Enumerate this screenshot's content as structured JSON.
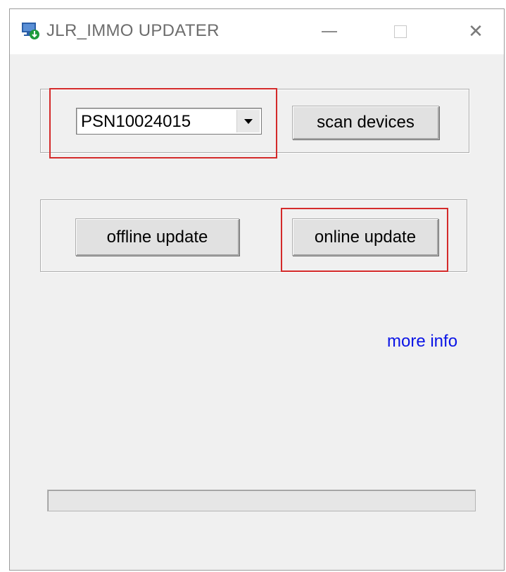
{
  "window": {
    "title": "JLR_IMMO UPDATER",
    "icon": "monitor-green-arrow-icon",
    "controls": [
      "minimize-icon",
      "maximize-icon",
      "close-icon"
    ],
    "close_glyph": "✕"
  },
  "device_select": {
    "selected_value": "PSN10024015"
  },
  "buttons": {
    "scan_devices": "scan devices",
    "offline_update": "offline update",
    "online_update": "online update"
  },
  "link": {
    "more_info": "more info",
    "color": "#0a14e6"
  },
  "progress": {
    "value": 0
  },
  "highlight_color": "#d42a2a"
}
